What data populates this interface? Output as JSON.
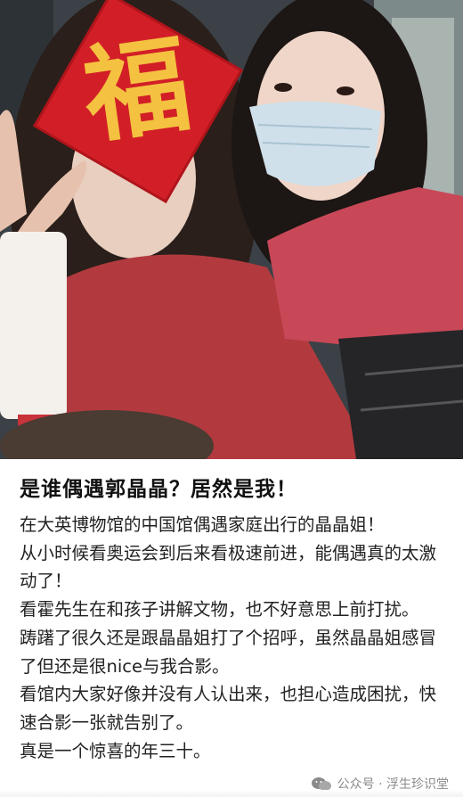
{
  "photo": {
    "description_icon": "photo-of-two-women-selfie",
    "sticker_char": "福"
  },
  "post": {
    "title": "是谁偶遇郭晶晶？居然是我！",
    "paragraphs": [
      "在大英博物馆的中国馆偶遇家庭出行的晶晶姐！",
      "从小时候看奥运会到后来看极速前进，能偶遇真的太激动了！",
      "看霍先生在和孩子讲解文物，也不好意思上前打扰。",
      "踌躇了很久还是跟晶晶姐打了个招呼，虽然晶晶姐感冒了但还是很nice与我合影。",
      "看馆内大家好像并没有人认出来，也担心造成困扰，快速合影一张就告别了。",
      "真是一个惊喜的年三十。"
    ]
  },
  "watermark": {
    "text": "公众号 · 浮生珍识堂",
    "icon": "wechat-icon"
  }
}
